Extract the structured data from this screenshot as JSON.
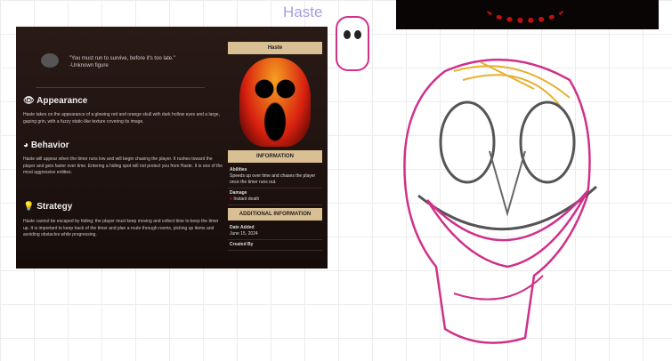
{
  "canvas_label": "Haste",
  "wiki": {
    "quote": "\"You must run to survive, before it's too late.\"",
    "quote_author": "-Unknown figure",
    "sections": [
      {
        "title": "Appearance",
        "text": "Haste takes on the appearance of a glowing red and orange skull with dark hollow eyes and a large, gaping grin, with a fuzzy static-like texture covering its image."
      },
      {
        "title": "Behavior",
        "text": "Haste will appear when the timer runs low and will begin chasing the player. It rushes toward the player and gets faster over time. Entering a hiding spot will not protect you from Haste. It is one of the most aggressive entities."
      },
      {
        "title": "Strategy",
        "text": "Haste cannot be escaped by hiding; the player must keep moving and collect time to keep the timer up. It is important to keep track of the timer and plan a route through rooms, picking up items and avoiding obstacles while progressing."
      }
    ],
    "infobox": {
      "name": "Haste",
      "info_header": "INFORMATION",
      "abilities_label": "Abilities",
      "abilities_text": "Speeds up over time and chases the player once the timer runs out.",
      "damage_label": "Damage",
      "damage_text": "Instant death",
      "additional_header": "ADDITIONAL INFORMATION",
      "date_label": "Date Added",
      "date_text": "June 15, 2024",
      "created_label": "Created By"
    }
  }
}
